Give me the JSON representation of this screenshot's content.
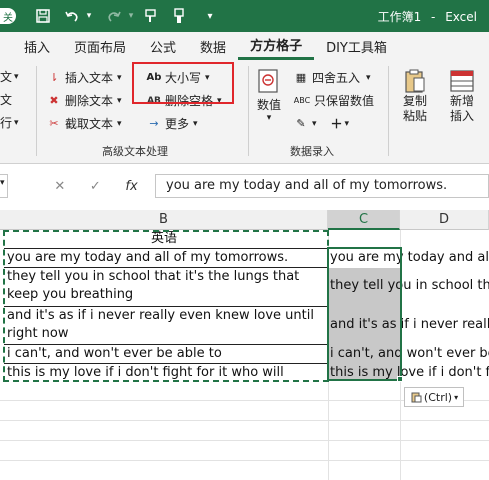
{
  "titlebar": {
    "autosave_glyph": "关",
    "workbook": "工作簿1",
    "app": "Excel",
    "icons": [
      "save-icon",
      "undo-icon",
      "redo-icon",
      "format-painter-icon",
      "quick-access-dropdown-icon"
    ]
  },
  "tabs": [
    "插入",
    "页面布局",
    "公式",
    "数据",
    "方方格子",
    "DIY工具箱"
  ],
  "active_tab": "方方格子",
  "ribbon": {
    "left_partial": [
      "文",
      "文",
      "行"
    ],
    "text_group": {
      "insert_text": "插入文本",
      "delete_text": "删除文本",
      "extract_text": "截取文本",
      "case": "大小写",
      "case_icon": "Ab",
      "delete_space": "删除空格",
      "delete_space_icon": "AB",
      "more": "更多",
      "label": "高级文本处理"
    },
    "numeric_group": {
      "numeric": "数值",
      "round": "四舍五入",
      "keep_value": "只保留数值",
      "keep_value_icon": "ABC",
      "label": "数据录入"
    },
    "copy_paste": "复制粘贴",
    "add_insert": "新增插入"
  },
  "formula_bar": {
    "cancel": "✕",
    "confirm": "✓",
    "fx": "fx",
    "value": "you are my today and all of my tomorrows."
  },
  "columns": [
    "B",
    "C",
    "D"
  ],
  "selected_column": "C",
  "cells": {
    "header": "英语",
    "b_rows": [
      "you are my today and all of my tomorrows.",
      "they tell you in school that it's the lungs that keep you breathing",
      "and it's as if i never really even knew love until right now",
      "i can't, and won't ever be able to",
      "this is my love if i don't fight for it who will"
    ],
    "c_rows": [
      "you are my today and all of my tomorrows.",
      "they tell you in school that it's the lungs that keep you breathing",
      "and it's as if i never really even knew love until right now",
      "i can't, and won't ever be able to",
      "this is my love if i don't fight for it who will"
    ]
  },
  "paste_options": "(Ctrl)",
  "colors": {
    "excel_green": "#217346",
    "highlight_red": "#e0262b"
  }
}
